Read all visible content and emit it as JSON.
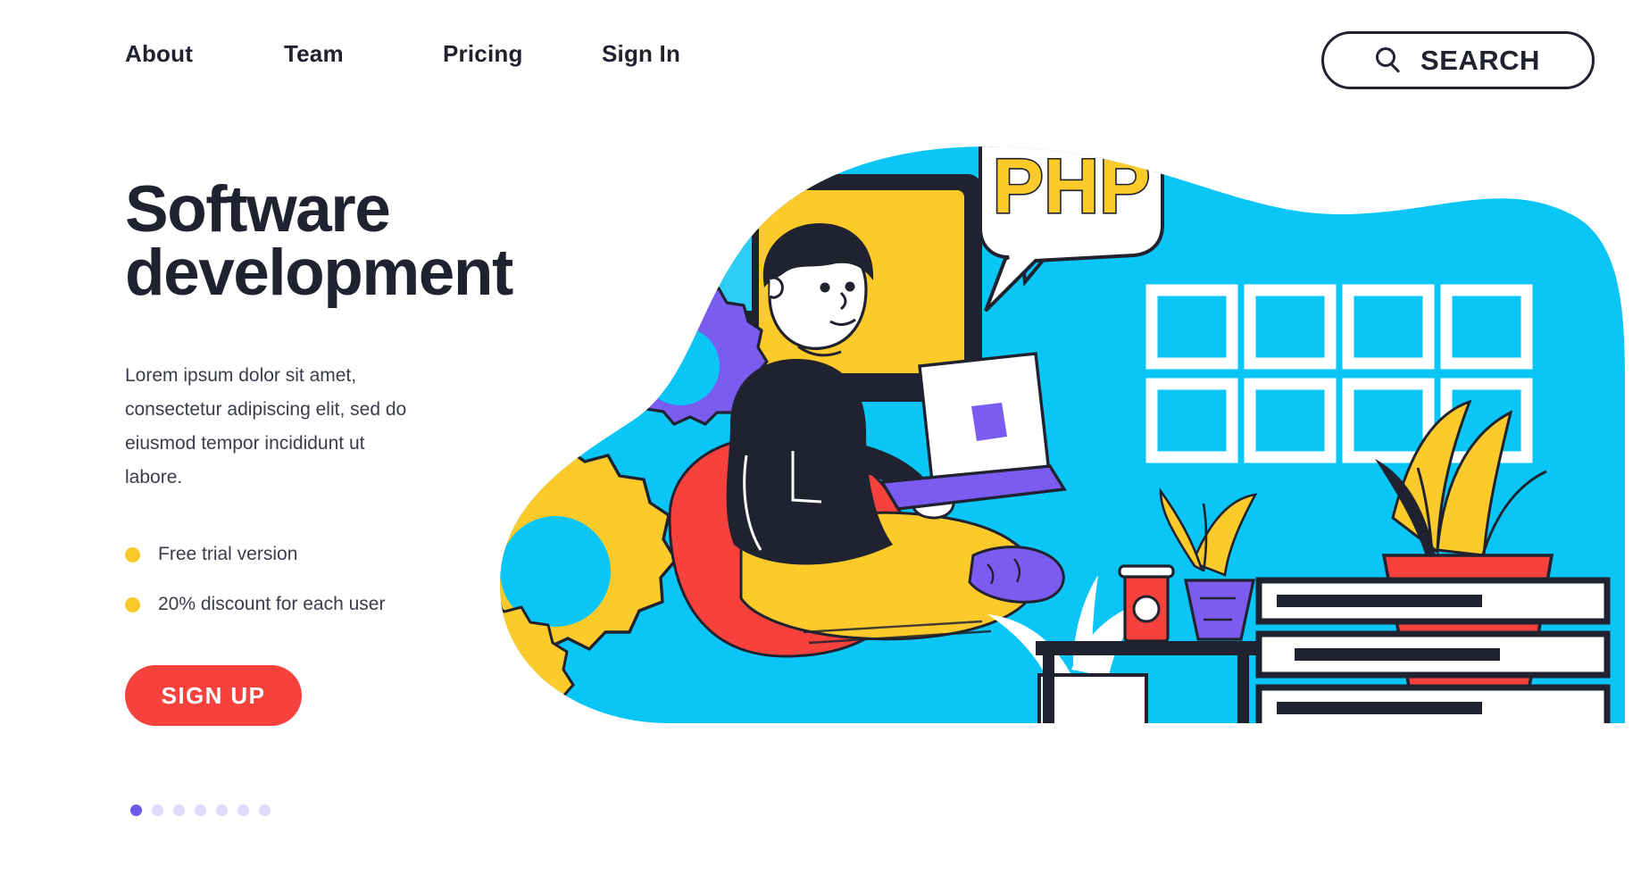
{
  "nav": {
    "items": [
      {
        "label": "About"
      },
      {
        "label": "Team"
      },
      {
        "label": "Pricing"
      },
      {
        "label": "Sign In"
      }
    ],
    "search": {
      "label": "SEARCH",
      "icon": "search-icon"
    }
  },
  "hero": {
    "headline_line1": "Software",
    "headline_line2": "development",
    "paragraph": "Lorem ipsum dolor sit amet, consectetur adipiscing elit, sed do eiusmod tempor incididunt ut labore.",
    "bullets": [
      {
        "label": "Free trial version"
      },
      {
        "label": "20% discount for each user"
      }
    ],
    "cta_label": "SIGN UP",
    "carousel": {
      "total": 7,
      "active_index": 0
    }
  },
  "illustration": {
    "speech_bubble_text": "PHP",
    "alt": "developer sitting on beanbag with laptop"
  },
  "colors": {
    "ink": "#20222F",
    "red": "#F7413C",
    "yellow": "#FCCB2B",
    "cyan": "#0AC6F7",
    "purple": "#7B5CF0",
    "white": "#FFFFFF"
  }
}
